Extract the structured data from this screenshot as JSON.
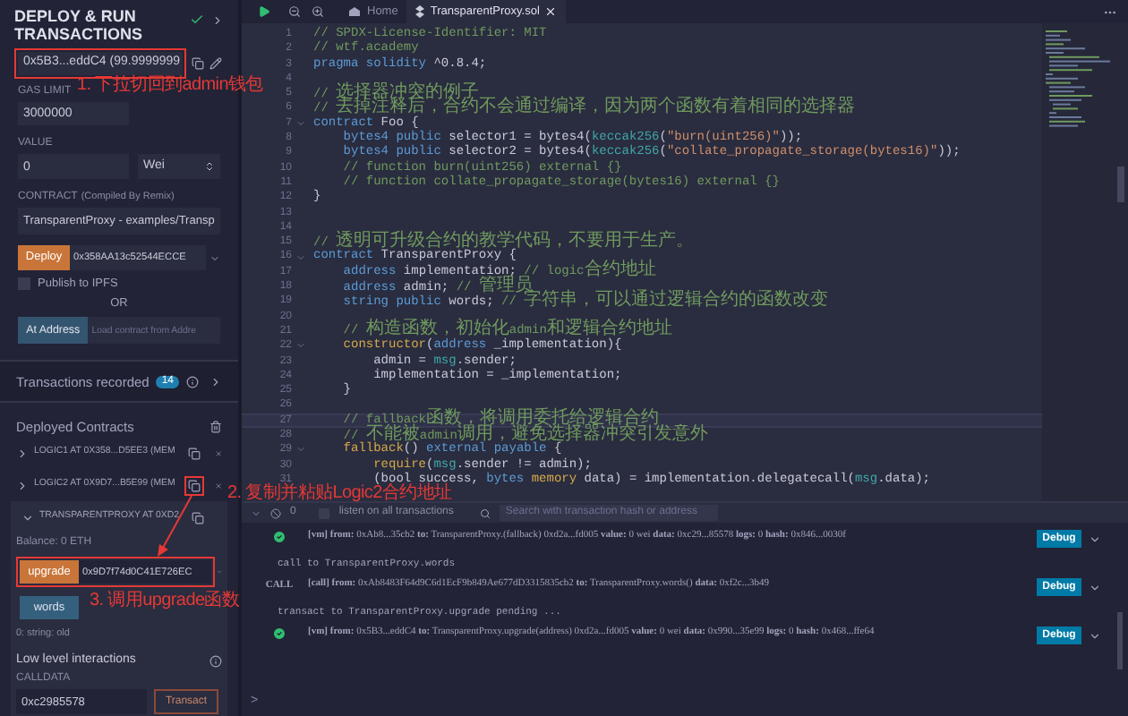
{
  "panel": {
    "title": "DEPLOY & RUN TRANSACTIONS",
    "account": {
      "value": "0x5B3...eddC4 (99.9999999",
      "highlighted": true
    },
    "gas_limit": {
      "label": "GAS LIMIT",
      "value": "3000000"
    },
    "value": {
      "label": "VALUE",
      "amount": "0",
      "unit": "Wei"
    },
    "contract": {
      "label": "CONTRACT",
      "note": "(Compiled By Remix)",
      "value": "TransparentProxy - examples/Transp"
    },
    "deploy": {
      "button": "Deploy",
      "argument": "0x358AA13c52544ECCE"
    },
    "publish": {
      "label": "Publish to IPFS",
      "checked": false
    },
    "or": "OR",
    "at_address": {
      "button": "At Address",
      "placeholder": "Load contract from Addre"
    },
    "transactions_recorded": {
      "label": "Transactions recorded",
      "count": "14"
    },
    "deployed": {
      "title": "Deployed Contracts",
      "contracts": [
        {
          "label": "LOGIC1 AT 0X358...D5EE3 (MEM",
          "expanded": false,
          "highlighted": false
        },
        {
          "label": "LOGIC2 AT 0X9D7...B5E99 (MEM",
          "expanded": false,
          "highlighted": true
        },
        {
          "label": "TRANSPARENTPROXY AT 0XD2",
          "expanded": true,
          "highlighted": false,
          "balance": "Balance: 0 ETH",
          "functions": [
            {
              "kind": "transact",
              "label": "upgrade",
              "value": "0x9D7f74d0C41E726EC",
              "highlighted": true
            },
            {
              "kind": "call",
              "label": "words",
              "highlighted": false
            }
          ],
          "output": "0: string: old",
          "low_level": {
            "title": "Low level interactions",
            "calldata_label": "CALLDATA",
            "calldata": "0xc2985578",
            "button": "Transact"
          }
        }
      ]
    }
  },
  "editor": {
    "tabs": [
      {
        "kind": "home",
        "label": "Home",
        "selected": false
      },
      {
        "kind": "file",
        "label": "TransparentProxy.sol",
        "selected": true
      }
    ],
    "lines": [
      {
        "n": "1",
        "fold": false,
        "current": false,
        "tokens": [
          {
            "kind": "comment",
            "text": "// SPDX-License-Identifier: MIT"
          }
        ]
      },
      {
        "n": "2",
        "fold": false,
        "current": false,
        "tokens": [
          {
            "kind": "comment",
            "text": "// wtf.academy"
          }
        ]
      },
      {
        "n": "3",
        "fold": false,
        "current": false,
        "tokens": [
          {
            "kind": "keyword",
            "text": "pragma solidity"
          },
          {
            "kind": "plain",
            "text": " ^0.8.4;"
          }
        ]
      },
      {
        "n": "4",
        "fold": false,
        "current": false
      },
      {
        "n": "5",
        "fold": false,
        "current": false,
        "tokens": [
          {
            "kind": "comment",
            "text": "// 选择器冲突的例子"
          }
        ]
      },
      {
        "n": "6",
        "fold": false,
        "current": false,
        "tokens": [
          {
            "kind": "comment",
            "text": "// 去掉注释后，合约不会通过编译，因为两个函数有着相同的选择器"
          }
        ]
      },
      {
        "n": "7",
        "fold": true,
        "current": false,
        "tokens": [
          {
            "kind": "keyword",
            "text": "contract"
          },
          {
            "kind": "plain",
            "text": " Foo {"
          }
        ]
      },
      {
        "n": "8",
        "fold": false,
        "current": false,
        "tokens": [
          {
            "kind": "keyword",
            "text": "    bytes4 public"
          },
          {
            "kind": "plain",
            "text": " selector1 = bytes4("
          },
          {
            "kind": "builtin",
            "text": "keccak256"
          },
          {
            "kind": "plain",
            "text": "("
          },
          {
            "kind": "string",
            "text": "\"burn(uint256)\""
          },
          {
            "kind": "plain",
            "text": "));"
          }
        ]
      },
      {
        "n": "9",
        "fold": false,
        "current": false,
        "tokens": [
          {
            "kind": "keyword",
            "text": "    bytes4 public"
          },
          {
            "kind": "plain",
            "text": " selector2 = bytes4("
          },
          {
            "kind": "builtin",
            "text": "keccak256"
          },
          {
            "kind": "plain",
            "text": "("
          },
          {
            "kind": "string",
            "text": "\"collate_propagate_storage(bytes16)\""
          },
          {
            "kind": "plain",
            "text": "));"
          }
        ]
      },
      {
        "n": "10",
        "fold": false,
        "current": false,
        "tokens": [
          {
            "kind": "comment",
            "text": "    // function burn(uint256) external {}"
          }
        ]
      },
      {
        "n": "11",
        "fold": false,
        "current": false,
        "tokens": [
          {
            "kind": "comment",
            "text": "    // function collate_propagate_storage(bytes16) external {}"
          }
        ]
      },
      {
        "n": "12",
        "fold": false,
        "current": false,
        "tokens": [
          {
            "kind": "plain",
            "text": "}"
          }
        ]
      },
      {
        "n": "13",
        "fold": false,
        "current": false
      },
      {
        "n": "14",
        "fold": false,
        "current": false
      },
      {
        "n": "15",
        "fold": false,
        "current": false,
        "tokens": [
          {
            "kind": "comment",
            "text": "// 透明可升级合约的教学代码，不要用于生产。"
          }
        ]
      },
      {
        "n": "16",
        "fold": true,
        "current": false,
        "tokens": [
          {
            "kind": "keyword",
            "text": "contract"
          },
          {
            "kind": "plain",
            "text": " TransparentProxy {"
          }
        ]
      },
      {
        "n": "17",
        "fold": false,
        "current": false,
        "tokens": [
          {
            "kind": "keyword",
            "text": "    address"
          },
          {
            "kind": "plain",
            "text": " implementation; "
          },
          {
            "kind": "comment",
            "text": "// logic合约地址"
          }
        ]
      },
      {
        "n": "18",
        "fold": false,
        "current": false,
        "tokens": [
          {
            "kind": "keyword",
            "text": "    address"
          },
          {
            "kind": "plain",
            "text": " admin; "
          },
          {
            "kind": "comment",
            "text": "// 管理员"
          }
        ]
      },
      {
        "n": "19",
        "fold": false,
        "current": false,
        "tokens": [
          {
            "kind": "keyword",
            "text": "    string public"
          },
          {
            "kind": "plain",
            "text": " words; "
          },
          {
            "kind": "comment",
            "text": "// 字符串，可以通过逻辑合约的函数改变"
          }
        ]
      },
      {
        "n": "20",
        "fold": false,
        "current": false
      },
      {
        "n": "21",
        "fold": false,
        "current": false,
        "tokens": [
          {
            "kind": "comment",
            "text": "    // 构造函数，初始化admin和逻辑合约地址"
          }
        ]
      },
      {
        "n": "22",
        "fold": true,
        "current": false,
        "tokens": [
          {
            "kind": "func",
            "text": "    constructor"
          },
          {
            "kind": "plain",
            "text": "("
          },
          {
            "kind": "keyword",
            "text": "address"
          },
          {
            "kind": "plain",
            "text": " _implementation){"
          }
        ]
      },
      {
        "n": "23",
        "fold": false,
        "current": false,
        "tokens": [
          {
            "kind": "plain",
            "text": "        admin = "
          },
          {
            "kind": "builtin",
            "text": "msg"
          },
          {
            "kind": "plain",
            "text": ".sender;"
          }
        ]
      },
      {
        "n": "24",
        "fold": false,
        "current": false,
        "tokens": [
          {
            "kind": "plain",
            "text": "        implementation = _implementation;"
          }
        ]
      },
      {
        "n": "25",
        "fold": false,
        "current": false,
        "tokens": [
          {
            "kind": "plain",
            "text": "    }"
          }
        ]
      },
      {
        "n": "26",
        "fold": false,
        "current": false
      },
      {
        "n": "27",
        "fold": false,
        "current": true,
        "tokens": [
          {
            "kind": "comment",
            "text": "    // fallback函数，将调用委托给逻辑合约"
          }
        ]
      },
      {
        "n": "28",
        "fold": false,
        "current": false,
        "tokens": [
          {
            "kind": "comment",
            "text": "    // 不能被admin调用，避免选择器冲突引发意外"
          }
        ]
      },
      {
        "n": "29",
        "fold": true,
        "current": false,
        "tokens": [
          {
            "kind": "func",
            "text": "    fallback"
          },
          {
            "kind": "plain",
            "text": "() "
          },
          {
            "kind": "keyword",
            "text": "external payable"
          },
          {
            "kind": "plain",
            "text": " {"
          }
        ]
      },
      {
        "n": "30",
        "fold": false,
        "current": false,
        "tokens": [
          {
            "kind": "func",
            "text": "        require"
          },
          {
            "kind": "plain",
            "text": "("
          },
          {
            "kind": "builtin",
            "text": "msg"
          },
          {
            "kind": "plain",
            "text": ".sender != admin);"
          }
        ]
      },
      {
        "n": "31",
        "fold": false,
        "current": false,
        "tokens": [
          {
            "kind": "plain",
            "text": "        (bool success, "
          },
          {
            "kind": "keyword",
            "text": "bytes"
          },
          {
            "kind": "func",
            "text": " memory"
          },
          {
            "kind": "plain",
            "text": " data) = implementation.delegatecall("
          },
          {
            "kind": "builtin",
            "text": "msg"
          },
          {
            "kind": "plain",
            "text": ".data);"
          }
        ]
      }
    ]
  },
  "terminal": {
    "count": "0",
    "listen": {
      "label": "listen on all transactions",
      "checked": false
    },
    "search": {
      "placeholder": "Search with transaction hash or address"
    },
    "entries": [
      {
        "kind": "vm",
        "text": "**[vm]** **from:** 0xAb8...35cb2 **to:** TransparentProxy.(fallback) 0xd2a...fd005 **value:** 0 wei **data:** 0xc29...85578 **logs:** 0 **hash:** 0x846...0030f",
        "button": "Debug"
      },
      {
        "kind": "note",
        "text": "call to TransparentProxy.words"
      },
      {
        "kind": "call",
        "badge": "CALL",
        "text": "**[call]** **from:** 0xAb8483F64d9C6d1EcF9b849Ae677dD3315835cb2 **to:** TransparentProxy.words() **data:** 0xf2c...3b49",
        "button": "Debug"
      },
      {
        "kind": "note",
        "text": "transact to TransparentProxy.upgrade pending ..."
      },
      {
        "kind": "vm",
        "text": "**[vm]** **from:** 0x5B3...eddC4 **to:** TransparentProxy.upgrade(address) 0xd2a...fd005 **value:** 0 wei **data:** 0x990...35e99 **logs:** 0 **hash:** 0x468...ffe64",
        "button": "Debug"
      }
    ],
    "prompt": ">"
  },
  "annotations": [
    {
      "text": "1. 下拉切回到admin钱包"
    },
    {
      "text": "2. 复制并粘贴Logic2合约地址"
    },
    {
      "text": "3. 调用upgrade函数"
    }
  ]
}
